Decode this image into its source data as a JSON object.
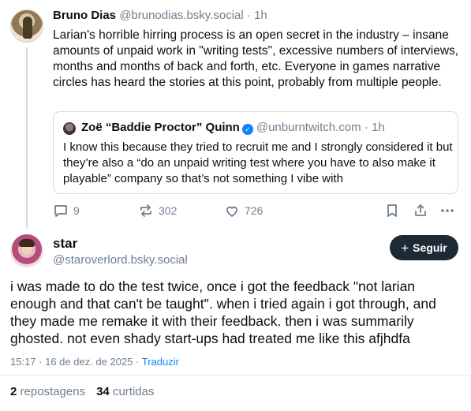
{
  "parent_post": {
    "author_name": "Bruno Dias",
    "author_handle": "@brunodias.bsky.social",
    "separator": "·",
    "time": "1h",
    "text": "Larian's horrible hirring process is an open secret in the industry – insane amounts of unpaid work in \"writing tests\", excessive numbers of interviews, months and months of back and forth, etc. Everyone in games narrative circles has heard the stories at this point, probably from multiple people.",
    "quote": {
      "author_name": "Zoë “Baddie Proctor” Quinn",
      "author_handle": "@unburntwitch.com",
      "separator": "·",
      "time": "1h",
      "text": "I know this because they tried to recruit me and I strongly considered it but they’re also a “do an unpaid writing test where you have to also make it playable” company so that’s not something I vibe with",
      "verified_icon": "check-badge-icon"
    },
    "actions": {
      "reply_count": "9",
      "repost_count": "302",
      "like_count": "726",
      "icons": [
        "reply-icon",
        "repost-icon",
        "heart-icon",
        "bookmark-icon",
        "share-icon",
        "more-icon"
      ]
    }
  },
  "main_post": {
    "author_name": "star",
    "author_handle": "@staroverlord.bsky.social",
    "follow_label": "Seguir",
    "follow_icon": "+",
    "text": "i was made to do the test twice, once i got the feedback \"not larian enough and that can't be taught\". when i tried again i got through, and they made me remake it with their feedback. then i was summarily ghosted. not even shady start-ups had treated me like this afjhdfa",
    "timestamp": "15:17 · 16 de dez. de 2025",
    "meta_separator": "·",
    "translate_label": "Traduzir",
    "reposts_count": "2",
    "reposts_label": "repostagens",
    "likes_count": "34",
    "likes_label": "curtidas"
  },
  "colors": {
    "text": "#0b0f14",
    "muted": "#6f7f8f",
    "link": "#1083fe",
    "follow_button": "#1e2936",
    "border": "#d4dbe2"
  }
}
